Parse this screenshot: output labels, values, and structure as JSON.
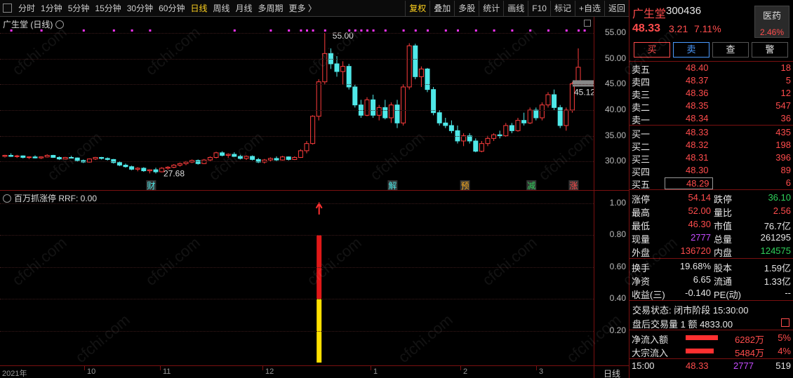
{
  "toolbar": {
    "periods": [
      "分时",
      "1分钟",
      "5分钟",
      "15分钟",
      "30分钟",
      "60分钟",
      "日线",
      "周线",
      "月线",
      "多周期",
      "更多 〉"
    ],
    "active": "日线",
    "right": [
      "复权",
      "叠加",
      "多股",
      "统计",
      "画线",
      "F10",
      "标记",
      "+自选",
      "返回"
    ]
  },
  "price_panel": {
    "title": "广生堂 (日线)",
    "y_ticks": [
      "55.00",
      "50.00",
      "45.00",
      "40.00",
      "35.00",
      "30.00"
    ],
    "high_label": "55.00",
    "low_label": "27.68",
    "last_label": "45.12",
    "markers": [
      "财",
      "解",
      "预",
      "减",
      "涨"
    ]
  },
  "indicator_panel": {
    "title": "百万抓涨停  RRF: 0.00",
    "y_ticks": [
      "1.00",
      "0.80",
      "0.60",
      "0.40",
      "0.20"
    ]
  },
  "x_axis": {
    "ticks": [
      "2021年",
      "10",
      "11",
      "12",
      "1",
      "2",
      "3"
    ],
    "mode": "日线"
  },
  "quote": {
    "name": "广生堂",
    "code": "300436",
    "sector": "医药",
    "sector_change": "2.46%",
    "price": "48.33",
    "change": "3.21",
    "change_pct": "7.11%",
    "buttons": [
      "买",
      "卖",
      "查",
      "警"
    ],
    "asks": [
      {
        "label": "卖五",
        "price": "48.40",
        "vol": "18"
      },
      {
        "label": "卖四",
        "price": "48.37",
        "vol": "5"
      },
      {
        "label": "卖三",
        "price": "48.36",
        "vol": "12"
      },
      {
        "label": "卖二",
        "price": "48.35",
        "vol": "547"
      },
      {
        "label": "卖一",
        "price": "48.34",
        "vol": "36"
      }
    ],
    "bids": [
      {
        "label": "买一",
        "price": "48.33",
        "vol": "435"
      },
      {
        "label": "买二",
        "price": "48.32",
        "vol": "198"
      },
      {
        "label": "买三",
        "price": "48.31",
        "vol": "396"
      },
      {
        "label": "买四",
        "price": "48.30",
        "vol": "89"
      },
      {
        "label": "买五",
        "price": "48.29",
        "vol": "6"
      }
    ],
    "stats": [
      {
        "l1": "涨停",
        "v1": "54.14",
        "c1": "red",
        "l2": "跌停",
        "v2": "36.10",
        "c2": "green"
      },
      {
        "l1": "最高",
        "v1": "52.00",
        "c1": "red",
        "l2": "量比",
        "v2": "2.56",
        "c2": "red"
      },
      {
        "l1": "最低",
        "v1": "46.30",
        "c1": "red",
        "l2": "市值",
        "v2": "76.7亿",
        "c2": "white"
      },
      {
        "l1": "现量",
        "v1": "2777",
        "c1": "purple",
        "l2": "总量",
        "v2": "261295",
        "c2": "white"
      },
      {
        "l1": "外盘",
        "v1": "136720",
        "c1": "red",
        "l2": "内盘",
        "v2": "124575",
        "c2": "green"
      }
    ],
    "stats2": [
      {
        "l1": "换手",
        "v1": "19.68%",
        "l2": "股本",
        "v2": "1.59亿"
      },
      {
        "l1": "净资",
        "v1": "6.65",
        "l2": "流通",
        "v2": "1.33亿"
      },
      {
        "l1": "收益(三)",
        "v1": "-0.140",
        "l2": "PE(动)",
        "v2": "--"
      }
    ],
    "trade_status": "交易状态: 闭市阶段 15:30:00",
    "after_hours": "盘后交易量 1 额 4833.00",
    "flows": [
      {
        "label": "净流入额",
        "value": "6282万",
        "pct": "5%"
      },
      {
        "label": "大宗流入",
        "value": "5484万",
        "pct": "4%"
      }
    ],
    "ticks": [
      {
        "time": "15:00",
        "price": "48.33",
        "vol": "2777",
        "num": "519"
      }
    ]
  },
  "watermark": "cfchi.com",
  "chart_data": {
    "type": "candlestick",
    "xlabel": "",
    "ylabel": "",
    "ylim": [
      26.5,
      56.5
    ],
    "candles": [
      [
        31,
        31.3,
        30.8,
        31.2
      ],
      [
        31.2,
        31.6,
        30.9,
        31.0
      ],
      [
        31.0,
        31.3,
        30.7,
        31.1
      ],
      [
        31.1,
        31.2,
        30.6,
        30.8
      ],
      [
        30.8,
        31.0,
        30.5,
        30.9
      ],
      [
        30.9,
        31.2,
        30.6,
        30.7
      ],
      [
        30.7,
        31.0,
        30.5,
        30.9
      ],
      [
        30.9,
        31.4,
        30.8,
        31.2
      ],
      [
        31.2,
        31.3,
        30.7,
        30.8
      ],
      [
        30.8,
        31.0,
        30.3,
        30.5
      ],
      [
        30.5,
        30.9,
        30.4,
        30.8
      ],
      [
        30.8,
        31.1,
        30.6,
        30.7
      ],
      [
        30.7,
        30.8,
        30.0,
        30.2
      ],
      [
        30.2,
        30.4,
        29.7,
        29.9
      ],
      [
        29.9,
        30.6,
        29.8,
        30.5
      ],
      [
        30.5,
        30.9,
        30.3,
        30.8
      ],
      [
        30.8,
        30.9,
        30.4,
        30.6
      ],
      [
        30.6,
        30.8,
        30.2,
        30.4
      ],
      [
        30.4,
        30.5,
        29.6,
        29.8
      ],
      [
        29.8,
        30.0,
        29.1,
        29.3
      ],
      [
        29.3,
        29.6,
        28.8,
        29.0
      ],
      [
        29.0,
        29.2,
        28.3,
        28.5
      ],
      [
        28.5,
        28.9,
        28.1,
        28.7
      ],
      [
        28.7,
        28.9,
        28.0,
        28.2
      ],
      [
        28.2,
        28.5,
        27.7,
        28.4
      ],
      [
        28.4,
        28.8,
        27.68,
        28.0
      ],
      [
        28.0,
        28.9,
        27.9,
        28.7
      ],
      [
        28.7,
        29.1,
        28.4,
        28.9
      ],
      [
        28.9,
        29.5,
        28.7,
        29.3
      ],
      [
        29.3,
        29.8,
        29.0,
        29.6
      ],
      [
        29.6,
        30.1,
        29.3,
        29.9
      ],
      [
        29.9,
        30.4,
        29.7,
        30.2
      ],
      [
        30.2,
        30.4,
        29.4,
        29.6
      ],
      [
        29.6,
        30.5,
        29.5,
        30.3
      ],
      [
        30.3,
        31.0,
        30.1,
        30.8
      ],
      [
        30.8,
        31.9,
        30.6,
        31.7
      ],
      [
        31.7,
        32.0,
        31.0,
        31.2
      ],
      [
        31.2,
        31.6,
        30.7,
        31.4
      ],
      [
        31.4,
        31.8,
        30.9,
        31.0
      ],
      [
        31.0,
        31.3,
        30.4,
        30.6
      ],
      [
        30.6,
        31.2,
        30.3,
        31.0
      ],
      [
        31.0,
        31.2,
        30.2,
        30.4
      ],
      [
        30.4,
        30.7,
        29.7,
        29.9
      ],
      [
        29.9,
        30.5,
        29.6,
        30.3
      ],
      [
        30.3,
        30.8,
        30.0,
        30.6
      ],
      [
        30.6,
        31.0,
        30.1,
        30.3
      ],
      [
        30.3,
        31.1,
        30.2,
        30.9
      ],
      [
        30.9,
        31.0,
        30.2,
        30.4
      ],
      [
        30.4,
        31.0,
        30.3,
        30.8
      ],
      [
        30.8,
        32.4,
        30.7,
        32.1
      ],
      [
        32.1,
        34.0,
        31.6,
        33.5
      ],
      [
        33.5,
        39.0,
        33.3,
        38.8
      ],
      [
        38.8,
        46.0,
        38.0,
        45.5
      ],
      [
        45.5,
        55.0,
        45.0,
        51.0
      ],
      [
        51.0,
        52.0,
        48.0,
        49.0
      ],
      [
        49.0,
        50.5,
        46.5,
        47.5
      ],
      [
        47.5,
        49.5,
        45.0,
        48.5
      ],
      [
        48.5,
        49.0,
        44.0,
        44.5
      ],
      [
        44.5,
        45.0,
        40.5,
        41.0
      ],
      [
        41.0,
        42.0,
        38.5,
        39.0
      ],
      [
        39.0,
        42.5,
        38.8,
        42.0
      ],
      [
        42.0,
        43.0,
        38.5,
        39.0
      ],
      [
        39.0,
        41.0,
        38.0,
        40.5
      ],
      [
        40.5,
        42.0,
        38.2,
        38.5
      ],
      [
        38.5,
        41.5,
        37.5,
        41.0
      ],
      [
        41.0,
        42.0,
        36.5,
        37.5
      ],
      [
        37.5,
        45.0,
        37.0,
        44.5
      ],
      [
        44.5,
        53.0,
        44.0,
        52.5
      ],
      [
        52.5,
        52.9,
        46.0,
        46.5
      ],
      [
        46.5,
        48.5,
        44.5,
        48.0
      ],
      [
        48.0,
        48.2,
        43.5,
        44.0
      ],
      [
        44.0,
        44.5,
        39.0,
        39.5
      ],
      [
        39.5,
        40.0,
        37.0,
        37.5
      ],
      [
        37.5,
        38.5,
        36.5,
        37.0
      ],
      [
        37.0,
        38.0,
        35.5,
        36.0
      ],
      [
        36.0,
        37.0,
        33.5,
        34.0
      ],
      [
        34.0,
        35.5,
        33.0,
        35.0
      ],
      [
        35.0,
        35.5,
        33.5,
        34.0
      ],
      [
        34.0,
        34.5,
        31.8,
        32.0
      ],
      [
        32.0,
        34.0,
        31.8,
        33.5
      ],
      [
        33.5,
        35.0,
        33.0,
        34.5
      ],
      [
        34.5,
        35.5,
        34.0,
        35.2
      ],
      [
        35.2,
        36.0,
        34.5,
        35.0
      ],
      [
        35.0,
        37.5,
        34.8,
        37.0
      ],
      [
        37.0,
        37.5,
        35.5,
        36.0
      ],
      [
        36.0,
        38.5,
        35.8,
        38.0
      ],
      [
        38.0,
        39.5,
        37.0,
        37.5
      ],
      [
        37.5,
        40.5,
        37.3,
        40.0
      ],
      [
        40.0,
        40.5,
        38.0,
        38.5
      ],
      [
        38.5,
        41.5,
        38.0,
        41.0
      ],
      [
        41.0,
        43.5,
        40.5,
        43.0
      ],
      [
        43.0,
        44.0,
        40.0,
        40.5
      ],
      [
        40.5,
        41.0,
        36.5,
        37.0
      ],
      [
        37.0,
        40.5,
        36.0,
        40.0
      ],
      [
        40.0,
        45.5,
        39.5,
        45.12
      ],
      [
        45.12,
        52.0,
        46.3,
        48.33
      ]
    ],
    "indicator": {
      "name": "百万抓涨停",
      "value": "RRF: 0.00",
      "bars": [
        {
          "index": 52,
          "value": 0.8
        }
      ]
    }
  }
}
